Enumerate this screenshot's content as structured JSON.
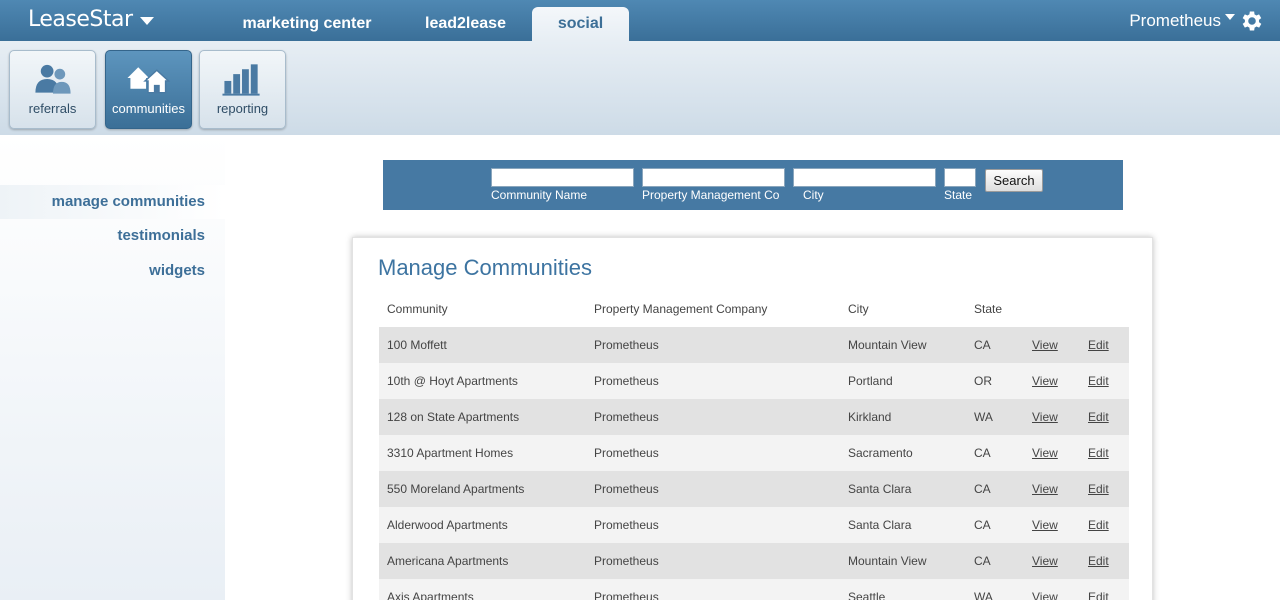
{
  "brand": {
    "name": "LeaseStar"
  },
  "nav": {
    "tabs": [
      {
        "label": "marketing center"
      },
      {
        "label": "lead2lease"
      },
      {
        "label": "social"
      }
    ]
  },
  "account": {
    "name": "Prometheus"
  },
  "toolbar": {
    "items": [
      {
        "label": "referrals",
        "icon": "people-icon"
      },
      {
        "label": "communities",
        "icon": "houses-icon"
      },
      {
        "label": "reporting",
        "icon": "bar-chart-icon"
      }
    ]
  },
  "sidebar": {
    "items": [
      {
        "label": "manage communities"
      },
      {
        "label": "testimonials"
      },
      {
        "label": "widgets"
      }
    ]
  },
  "search": {
    "community_name_label": "Community Name",
    "community_name_value": "",
    "pm_label": "Property Management Co",
    "pm_value": "",
    "city_label": "City",
    "city_value": "",
    "state_label": "State",
    "state_value": "",
    "button_label": "Search"
  },
  "main": {
    "title": "Manage Communities",
    "columns": [
      "Community",
      "Property Management Company",
      "City",
      "State"
    ],
    "view_label": "View",
    "edit_label": "Edit",
    "rows": [
      {
        "community": "100 Moffett",
        "pm": "Prometheus",
        "city": "Mountain View",
        "state": "CA"
      },
      {
        "community": "10th @ Hoyt Apartments",
        "pm": "Prometheus",
        "city": "Portland",
        "state": "OR"
      },
      {
        "community": "128 on State Apartments",
        "pm": "Prometheus",
        "city": "Kirkland",
        "state": "WA"
      },
      {
        "community": "3310 Apartment Homes",
        "pm": "Prometheus",
        "city": "Sacramento",
        "state": "CA"
      },
      {
        "community": "550 Moreland Apartments",
        "pm": "Prometheus",
        "city": "Santa Clara",
        "state": "CA"
      },
      {
        "community": "Alderwood Apartments",
        "pm": "Prometheus",
        "city": "Santa Clara",
        "state": "CA"
      },
      {
        "community": "Americana Apartments",
        "pm": "Prometheus",
        "city": "Mountain View",
        "state": "CA"
      },
      {
        "community": "Axis Apartments",
        "pm": "Prometheus",
        "city": "Seattle",
        "state": "WA"
      }
    ]
  },
  "colors": {
    "header": "#4679a3",
    "accent_text": "#3d74a1",
    "row_dark": "#e2e2e2",
    "row_light": "#f3f3f3"
  }
}
